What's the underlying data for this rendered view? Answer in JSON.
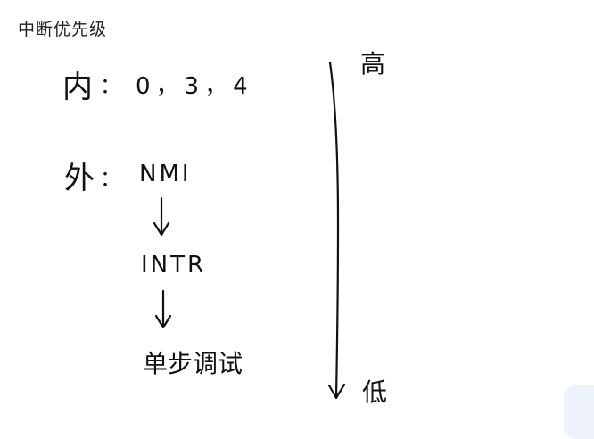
{
  "page": {
    "title": "中断优先级"
  },
  "diagram": {
    "internal": {
      "label": "内",
      "separator": "：",
      "values": "0，3，4"
    },
    "external": {
      "label": "外",
      "separator": "：",
      "first": "NMI"
    },
    "chain": [
      "INTR",
      "单步调试"
    ],
    "scale": {
      "high": "高",
      "low": "低"
    }
  }
}
